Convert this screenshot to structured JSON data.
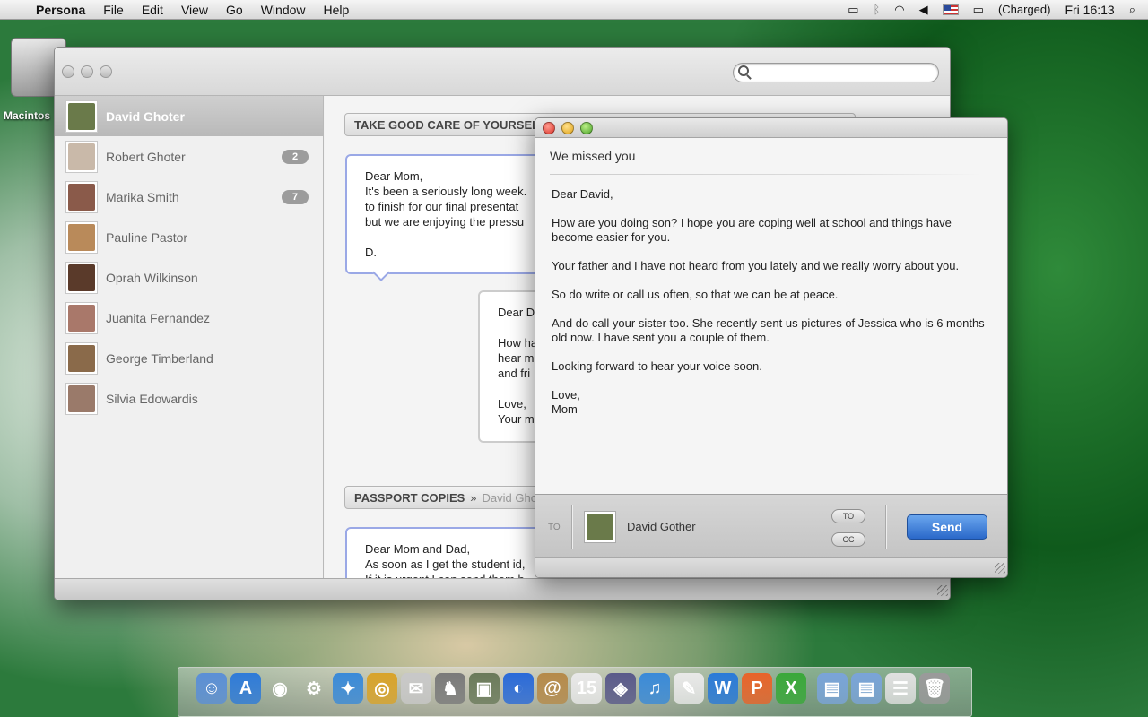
{
  "menubar": {
    "app_name": "Persona",
    "menus": [
      "File",
      "Edit",
      "View",
      "Go",
      "Window",
      "Help"
    ],
    "battery_status": "(Charged)",
    "clock": "Fri 16:13"
  },
  "desktop": {
    "disk_label": "Macintos"
  },
  "main_window": {
    "search_placeholder": "",
    "contacts": [
      {
        "name": "David Ghoter",
        "badge": "",
        "selected": true,
        "avatar_color": "#6a7a4a"
      },
      {
        "name": "Robert Ghoter",
        "badge": "2",
        "selected": false,
        "avatar_color": "#c9b9a9"
      },
      {
        "name": "Marika Smith",
        "badge": "7",
        "selected": false,
        "avatar_color": "#8a5a4a"
      },
      {
        "name": "Pauline Pastor",
        "badge": "",
        "selected": false,
        "avatar_color": "#b98a5a"
      },
      {
        "name": "Oprah Wilkinson",
        "badge": "",
        "selected": false,
        "avatar_color": "#5a3a2a"
      },
      {
        "name": "Juanita Fernandez",
        "badge": "",
        "selected": false,
        "avatar_color": "#a9786a"
      },
      {
        "name": "George Timberland",
        "badge": "",
        "selected": false,
        "avatar_color": "#8a6a4a"
      },
      {
        "name": "Silvia Edowardis",
        "badge": "",
        "selected": false,
        "avatar_color": "#9a7a6a"
      }
    ],
    "threads": [
      {
        "subject": "TAKE GOOD CARE OF YOURSELF",
        "separator": "»",
        "participant": "",
        "messages": [
          {
            "text": "Dear Mom,\nIt's been a seriously long week.\nto finish for our final presentat\nbut we are enjoying the pressu\n\nD."
          },
          {
            "text": "Dear D\n\nHow ha\nhear m\nand fri\n\nLove,\nYour m"
          }
        ]
      },
      {
        "subject": "PASSPORT COPIES",
        "separator": "»",
        "participant": "David Ghot",
        "messages": [
          {
            "text": "Dear Mom and Dad,\nAs soon as I get the student id,\nIf it is urgent I can send them b"
          }
        ]
      }
    ]
  },
  "compose": {
    "subject": "We missed you",
    "body": [
      "Dear David,",
      "How are you doing son? I hope you are coping well at school and things have become easier for you.",
      "Your father and I have not heard from you lately and we really worry about you.",
      "So do write or call us often, so that we can be at peace.",
      "And do call your sister too. She recently sent us pictures of Jessica who is 6 months old now. I have sent you a couple of them.",
      "Looking forward to hear your voice soon.",
      "Love,\nMom"
    ],
    "to_label": "TO",
    "recipient": "David Gother",
    "to_button": "TO",
    "cc_button": "CC",
    "send_label": "Send"
  },
  "dock": {
    "items": [
      {
        "name": "finder",
        "color": "#5b8fd6",
        "glyph": "☺"
      },
      {
        "name": "app-store",
        "color": "#2f7bd8",
        "glyph": "A"
      },
      {
        "name": "dashboard",
        "color": "#333",
        "glyph": "◉"
      },
      {
        "name": "system-preferences",
        "color": "#888",
        "glyph": "⚙"
      },
      {
        "name": "safari",
        "color": "#3a8ad8",
        "glyph": "✦"
      },
      {
        "name": "chrome",
        "color": "#d8a32a",
        "glyph": "◎"
      },
      {
        "name": "mail",
        "color": "#c8c8c8",
        "glyph": "✉"
      },
      {
        "name": "chess",
        "color": "#7a7a7a",
        "glyph": "♞"
      },
      {
        "name": "iphoto",
        "color": "#6a7a5a",
        "glyph": "▣"
      },
      {
        "name": "dvd-player",
        "color": "#2a6ad8",
        "glyph": "◐"
      },
      {
        "name": "address-book",
        "color": "#b58a4a",
        "glyph": "@"
      },
      {
        "name": "ical",
        "color": "#e8e8e8",
        "glyph": "15"
      },
      {
        "name": "photo-booth",
        "color": "#5a5a8a",
        "glyph": "◈"
      },
      {
        "name": "itunes",
        "color": "#3a8ad8",
        "glyph": "♫"
      },
      {
        "name": "textedit",
        "color": "#e8e8e8",
        "glyph": "✎"
      },
      {
        "name": "word",
        "color": "#2a7ad8",
        "glyph": "W"
      },
      {
        "name": "powerpoint",
        "color": "#e8642a",
        "glyph": "P"
      },
      {
        "name": "excel",
        "color": "#3aa83a",
        "glyph": "X"
      },
      {
        "name": "applications-folder",
        "color": "#7aa4d8",
        "glyph": "▤"
      },
      {
        "name": "documents-folder",
        "color": "#7aa4d8",
        "glyph": "▤"
      },
      {
        "name": "downloads-stack",
        "color": "#e0e0e0",
        "glyph": "☰"
      },
      {
        "name": "trash",
        "color": "#9a9a9a",
        "glyph": "🗑"
      }
    ]
  }
}
